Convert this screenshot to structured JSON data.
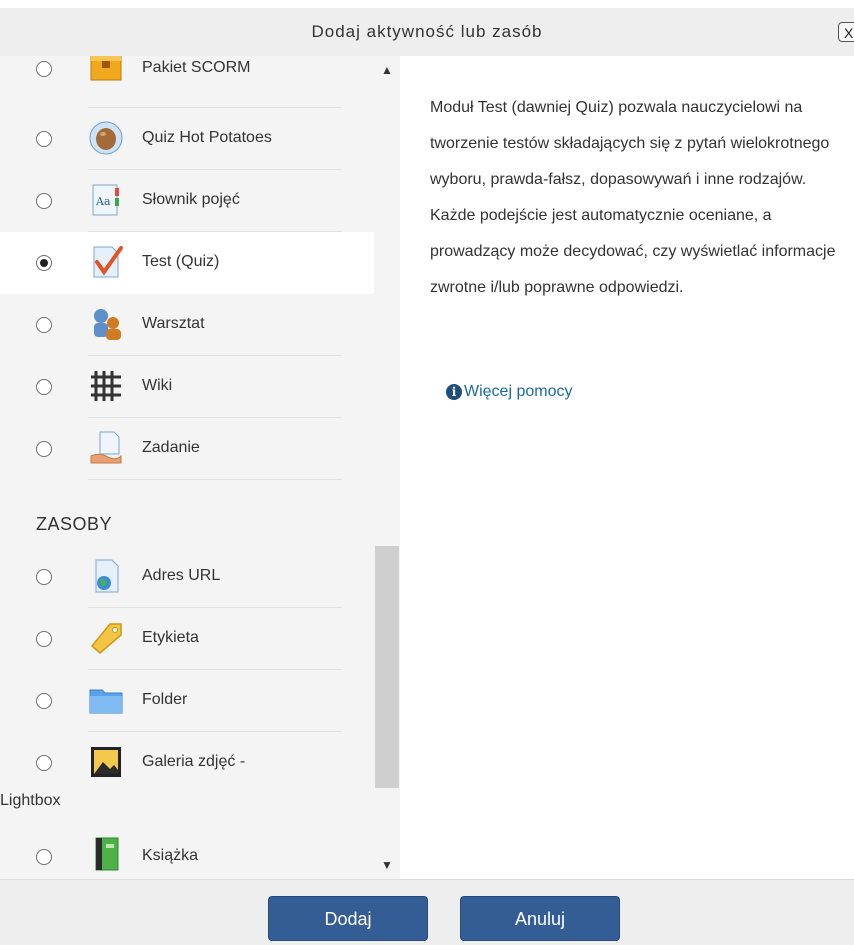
{
  "dialog": {
    "title": "Dodaj aktywność lub zasób",
    "close_label": "X"
  },
  "activities": [
    {
      "label": "Pakiet SCORM",
      "icon": "scorm-package-icon",
      "selected": false
    },
    {
      "label": "Quiz Hot Potatoes",
      "icon": "hot-potatoes-icon",
      "selected": false
    },
    {
      "label": "Słownik pojęć",
      "icon": "glossary-icon",
      "selected": false
    },
    {
      "label": "Test (Quiz)",
      "icon": "quiz-icon",
      "selected": true
    },
    {
      "label": "Warsztat",
      "icon": "workshop-icon",
      "selected": false
    },
    {
      "label": "Wiki",
      "icon": "wiki-icon",
      "selected": false
    },
    {
      "label": "Zadanie",
      "icon": "assignment-icon",
      "selected": false
    }
  ],
  "resources_heading": "ZASOBY",
  "resources": [
    {
      "label": "Adres URL",
      "icon": "url-icon",
      "selected": false
    },
    {
      "label": "Etykieta",
      "icon": "label-icon",
      "selected": false
    },
    {
      "label": "Folder",
      "icon": "folder-icon",
      "selected": false
    },
    {
      "label": "Galeria zdjęć -",
      "label_wrap": "Lightbox",
      "icon": "gallery-icon",
      "selected": false
    },
    {
      "label": "Książka",
      "icon": "book-icon",
      "selected": false
    }
  ],
  "description": {
    "text": "Moduł Test (dawniej Quiz) pozwala nauczycielowi na tworzenie testów składających się z pytań wielokrotnego wyboru, prawda-fałsz, dopasowywań i inne rodzajów. Każde podejście jest automatycznie oceniane, a prowadzący może decydować, czy wyświetlać informacje zwrotne i/lub poprawne odpowiedzi.",
    "help_link": "Więcej pomocy"
  },
  "footer": {
    "add_label": "Dodaj",
    "cancel_label": "Anuluj"
  },
  "colors": {
    "button_bg": "#345c95",
    "link": "#1a6aa8",
    "list_bg": "#f4f4f4"
  }
}
